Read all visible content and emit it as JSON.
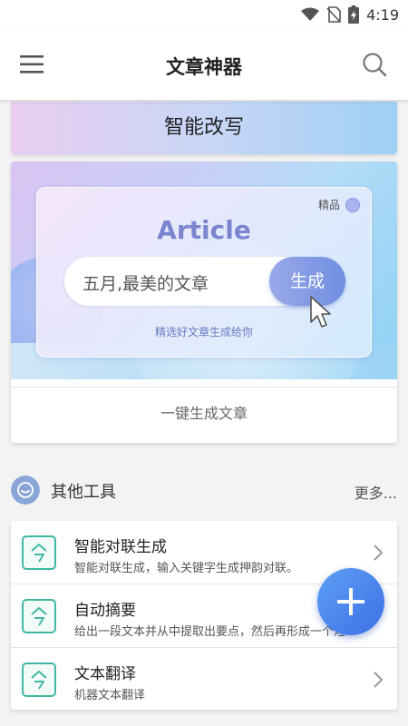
{
  "status": {
    "time": "4:19"
  },
  "app": {
    "title": "文章神器"
  },
  "banner": {
    "label": "智能改写"
  },
  "feature": {
    "brand_text": "Article",
    "badge": "精品",
    "input_text": "五月,最美的文章",
    "button_label": "生成",
    "subline": "精选好文章生成给你",
    "caption": "一键生成文章"
  },
  "tools_section": {
    "title": "其他工具",
    "more": "更多..."
  },
  "tools": [
    {
      "title": "智能对联生成",
      "desc": "智能对联生成，输入关键字生成押韵对联。"
    },
    {
      "title": "自动摘要",
      "desc": "给出一段文本并从中提取出要点，然后再形成一个短的概括"
    },
    {
      "title": "文本翻译",
      "desc": "机器文本翻译"
    }
  ],
  "colors": {
    "accent": "#3b6fe4",
    "tool_icon": "#3fb8a3"
  },
  "icons": [
    "wifi-icon",
    "no-sim-icon",
    "battery-charging-icon",
    "menu-icon",
    "search-icon",
    "chevron-right-icon",
    "plus-icon"
  ]
}
